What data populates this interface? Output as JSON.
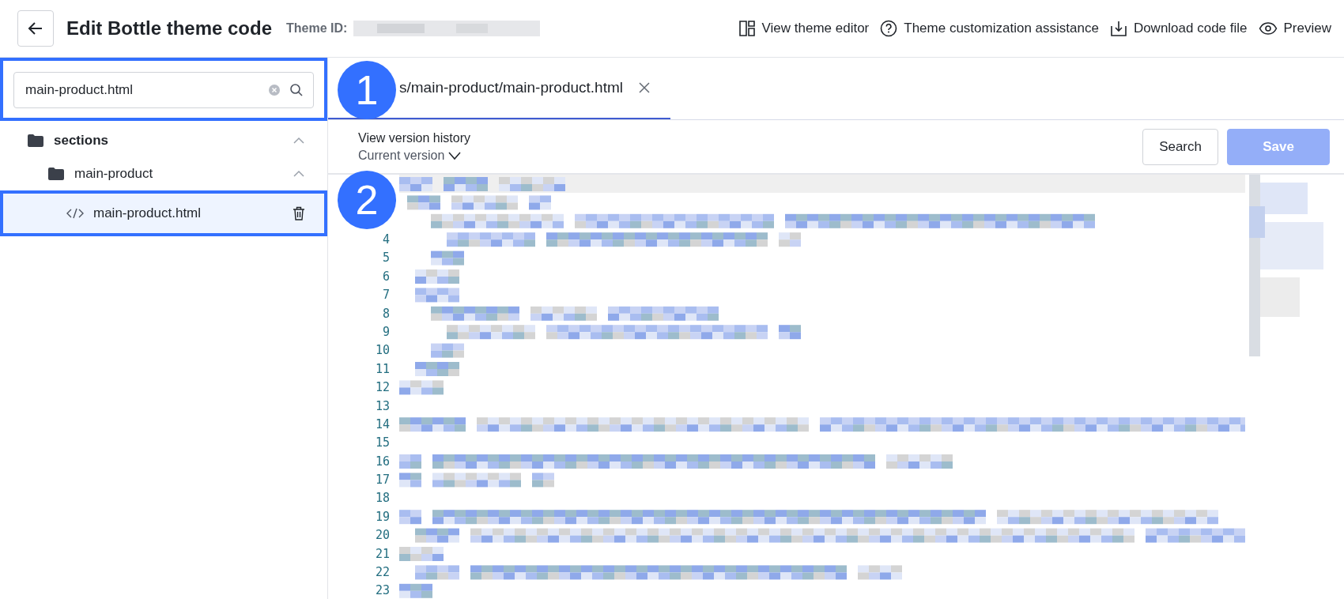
{
  "header": {
    "title": "Edit Bottle theme code",
    "theme_id_label": "Theme ID:",
    "actions": [
      {
        "label": "View theme editor",
        "kind": "layout"
      },
      {
        "label": "Theme customization assistance",
        "kind": "help"
      },
      {
        "label": "Download code file",
        "kind": "download"
      },
      {
        "label": "Preview",
        "kind": "preview"
      }
    ]
  },
  "sidebar": {
    "search": {
      "value": "main-product.html",
      "highlighted": true
    },
    "tree": [
      {
        "kind": "folder",
        "name": "sections",
        "expanded": true,
        "children": [
          {
            "kind": "folder",
            "name": "main-product",
            "expanded": true,
            "children": [
              {
                "kind": "file",
                "name": "main-product.html",
                "selected": true,
                "highlighted": true
              }
            ]
          }
        ]
      }
    ]
  },
  "editor": {
    "tabs": [
      {
        "label": "s/main-product/main-product.html",
        "selected": true
      }
    ],
    "version_history": "View version history",
    "version": "Current version",
    "buttons": [
      {
        "label": "Search",
        "kind": "default",
        "disabled": false
      },
      {
        "label": "Save",
        "kind": "primary",
        "disabled": true
      }
    ],
    "line_numbers": [
      "4",
      "5",
      "6",
      "7",
      "8",
      "9",
      "10",
      "11",
      "12",
      "13",
      "14",
      "15",
      "16",
      "17",
      "18",
      "19",
      "20",
      "21",
      "22",
      "23"
    ]
  },
  "annotations": [
    {
      "label": "1"
    },
    {
      "label": "2"
    }
  ]
}
